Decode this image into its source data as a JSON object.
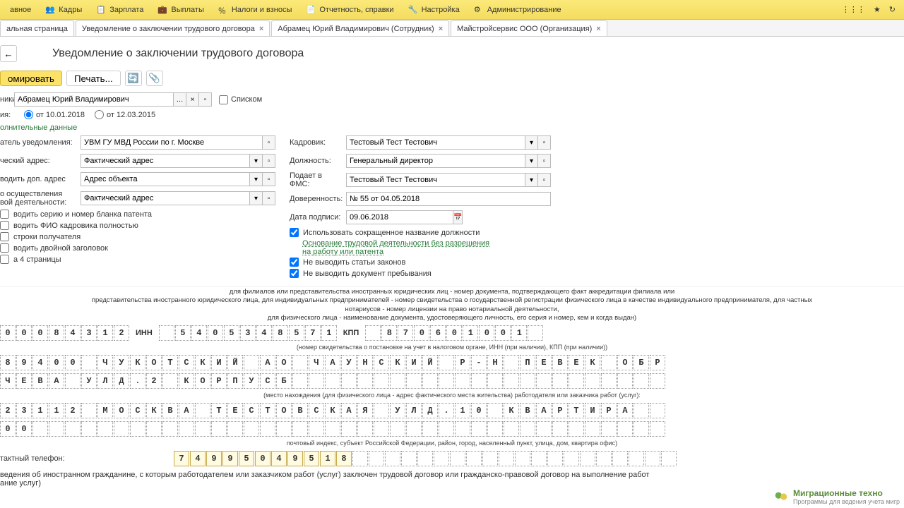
{
  "menu": [
    "авное",
    "Кадры",
    "Зарплата",
    "Выплаты",
    "Налоги и взносы",
    "Отчетность, справки",
    "Настройка",
    "Администрирование"
  ],
  "tabs": [
    "альная страница",
    "Уведомление о заключении трудового договора",
    "Абрамец Юрий Владимирович (Сотрудник)",
    "Майстройсервис ООО (Организация)"
  ],
  "pageTitle": "Уведомление о заключении трудового договора",
  "toolbar": {
    "form": "омировать",
    "print": "Печать..."
  },
  "fields": {
    "employeesLabel": "ники:",
    "employee": "Абрамец Юрий Владимирович",
    "listLabel": "Списком",
    "dateLabel": "ия:",
    "dateOpt1": "от 10.01.2018",
    "dateOpt2": "от 12.03.2015",
    "additionalData": "олнительные данные",
    "notifierLabel": "атель уведомления:",
    "notifier": "УВМ ГУ МВД России по г. Москве",
    "addressLabel": "ческий адрес:",
    "address": "Фактический адрес",
    "addAddressLabel": "водить доп. адрес",
    "addAddress": "Адрес объекта",
    "activityPlaceLabel1": "о осуществления",
    "activityPlaceLabel2": "вой деятельности:",
    "activityPlace": "Фактический адрес",
    "chk1": "водить серию и номер бланка патента",
    "chk2": "водить ФИО кадровика полностью",
    "chk3": "строки получателя",
    "chk4": "водить двойной заголовок",
    "chk5": "а 4 страницы",
    "hrLabel": "Кадровик:",
    "hr": "Тестовый Тест Тестович",
    "positionLabel": "Должность:",
    "position": "Генеральный директор",
    "fmsLabel": "Подает в ФМС:",
    "fms": "Тестовый Тест Тестович",
    "proxyLabel": "Доверенность:",
    "proxy": "№ 55 от 04.05.2018",
    "signDateLabel": "Дата подписи:",
    "signDate": "09.06.2018",
    "useShort": "Использовать сокращенное название должности",
    "basis": "Основание трудовой деятельности без разрешения на работу или патента",
    "noLaws": "Не выводить статьи законов",
    "noDoc": "Не выводить документ пребывания"
  },
  "docText1": "для филиалов или представительства иностранных юридических лиц - номер документа, подтверждающего факт аккредитации филиала или",
  "docText2": "представительства иностранного юридического лица, для индивидуальных предпринимателей - номер свидетельства о государственной регистрации физического лица в качестве индивидуального предпринимателя, для частных",
  "docText3": "нотариусов - номер лицензии на право нотариальной деятельности,",
  "docText4": "для физического лица - наименование документа, удостоверяющего личность, его серия и номер, кем и когда выдан)",
  "row1Prefix": [
    "0",
    "0",
    "0",
    "8",
    "4",
    "3",
    "1",
    "2"
  ],
  "row1Inn": "ИНН",
  "row1Mid": [
    "",
    "5",
    "4",
    "0",
    "5",
    "3",
    "4",
    "8",
    "5",
    "7",
    "1"
  ],
  "row1Kpp": "КПП",
  "row1End": [
    "",
    "8",
    "7",
    "0",
    "6",
    "0",
    "1",
    "0",
    "0",
    "1",
    ""
  ],
  "caption1": "(номер свидетельства о постановке на учет в налоговом органе, ИНН (при наличии), КПП (при наличии))",
  "row2": [
    "8",
    "9",
    "4",
    "0",
    "0",
    "",
    "Ч",
    "У",
    "К",
    "О",
    "Т",
    "С",
    "К",
    "И",
    "Й",
    "",
    "А",
    "О",
    "",
    "Ч",
    "А",
    "У",
    "Н",
    "С",
    "К",
    "И",
    "Й",
    "",
    "Р",
    "-",
    "Н",
    "",
    "П",
    "Е",
    "В",
    "Е",
    "К",
    "",
    "О",
    "Б",
    "Р"
  ],
  "row3": [
    "Ч",
    "Е",
    "В",
    "А",
    "",
    "У",
    "Л",
    "Д",
    ".",
    "2",
    "",
    "К",
    "О",
    "Р",
    "П",
    "У",
    "С",
    "Б",
    "",
    "",
    "",
    "",
    "",
    "",
    "",
    "",
    "",
    "",
    "",
    "",
    "",
    "",
    "",
    "",
    "",
    "",
    "",
    "",
    "",
    "",
    ""
  ],
  "caption2": "(место нахождения (для физического лица - адрес фактического места жительства) работодателя или заказчика работ (услуг):",
  "row4": [
    "2",
    "3",
    "1",
    "1",
    "2",
    "",
    "М",
    "О",
    "С",
    "К",
    "В",
    "А",
    "",
    "Т",
    "Е",
    "С",
    "Т",
    "О",
    "В",
    "С",
    "К",
    "А",
    "Я",
    "",
    "У",
    "Л",
    "Д",
    ".",
    "1",
    "0",
    "",
    "К",
    "В",
    "А",
    "Р",
    "Т",
    "И",
    "Р",
    "А",
    "",
    ""
  ],
  "row5": [
    "0",
    "0",
    "",
    "",
    "",
    "",
    "",
    "",
    "",
    "",
    "",
    "",
    "",
    "",
    "",
    "",
    "",
    "",
    "",
    "",
    "",
    "",
    "",
    "",
    "",
    "",
    "",
    "",
    "",
    "",
    "",
    "",
    "",
    "",
    "",
    "",
    "",
    "",
    "",
    "",
    ""
  ],
  "caption3": "почтовый индекс, субъект Российской Федерации, район, город, населенный пункт, улица, дом, квартира офис)",
  "phoneLabel": "тактный телефон:",
  "phone": [
    "7",
    "4",
    "9",
    "9",
    "5",
    "0",
    "4",
    "9",
    "5",
    "1",
    "8"
  ],
  "footerText": "ведения об иностранном гражданине, с которым работодателем или заказчиком работ (услуг) заключен трудовой договор или гражданско-правовой договор на выполнение работ",
  "footerText2": "ание услуг)",
  "brand1": "Миграционные техно",
  "brand2": "Программы для ведения учета мигр"
}
